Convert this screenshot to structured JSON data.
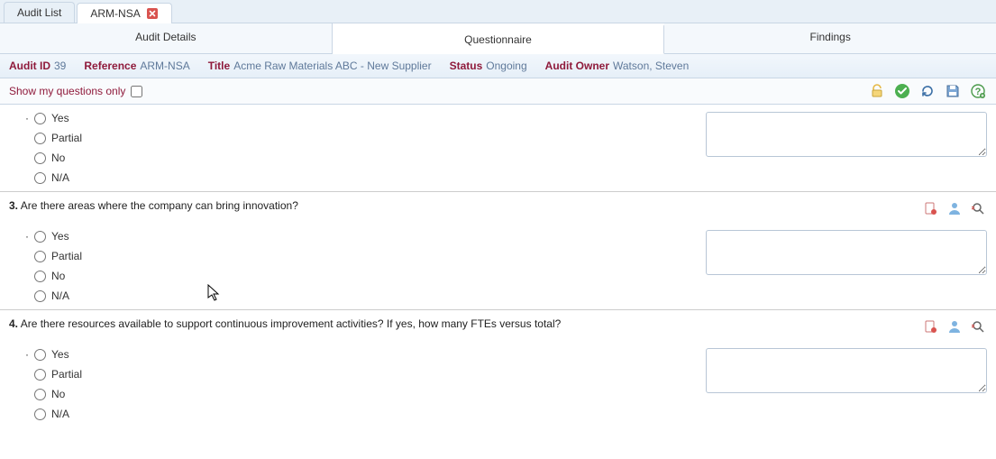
{
  "tabs": {
    "audit_list": "Audit List",
    "current": "ARM-NSA"
  },
  "subtabs": {
    "details": "Audit Details",
    "questionnaire": "Questionnaire",
    "findings": "Findings"
  },
  "info": {
    "audit_id_label": "Audit ID",
    "audit_id": "39",
    "reference_label": "Reference",
    "reference": "ARM-NSA",
    "title_label": "Title",
    "title": "Acme Raw Materials ABC - New Supplier",
    "status_label": "Status",
    "status": "Ongoing",
    "owner_label": "Audit Owner",
    "owner": "Watson, Steven"
  },
  "toolbar": {
    "show_my_questions": "Show my questions only"
  },
  "options": {
    "yes": "Yes",
    "partial": "Partial",
    "no": "No",
    "na": "N/A"
  },
  "questions": {
    "q3_num": "3.",
    "q3_text": " Are there areas where the company can bring innovation?",
    "q4_num": "4.",
    "q4_text": " Are there resources available to support continuous improvement activities? If yes, how many FTEs versus total?"
  }
}
